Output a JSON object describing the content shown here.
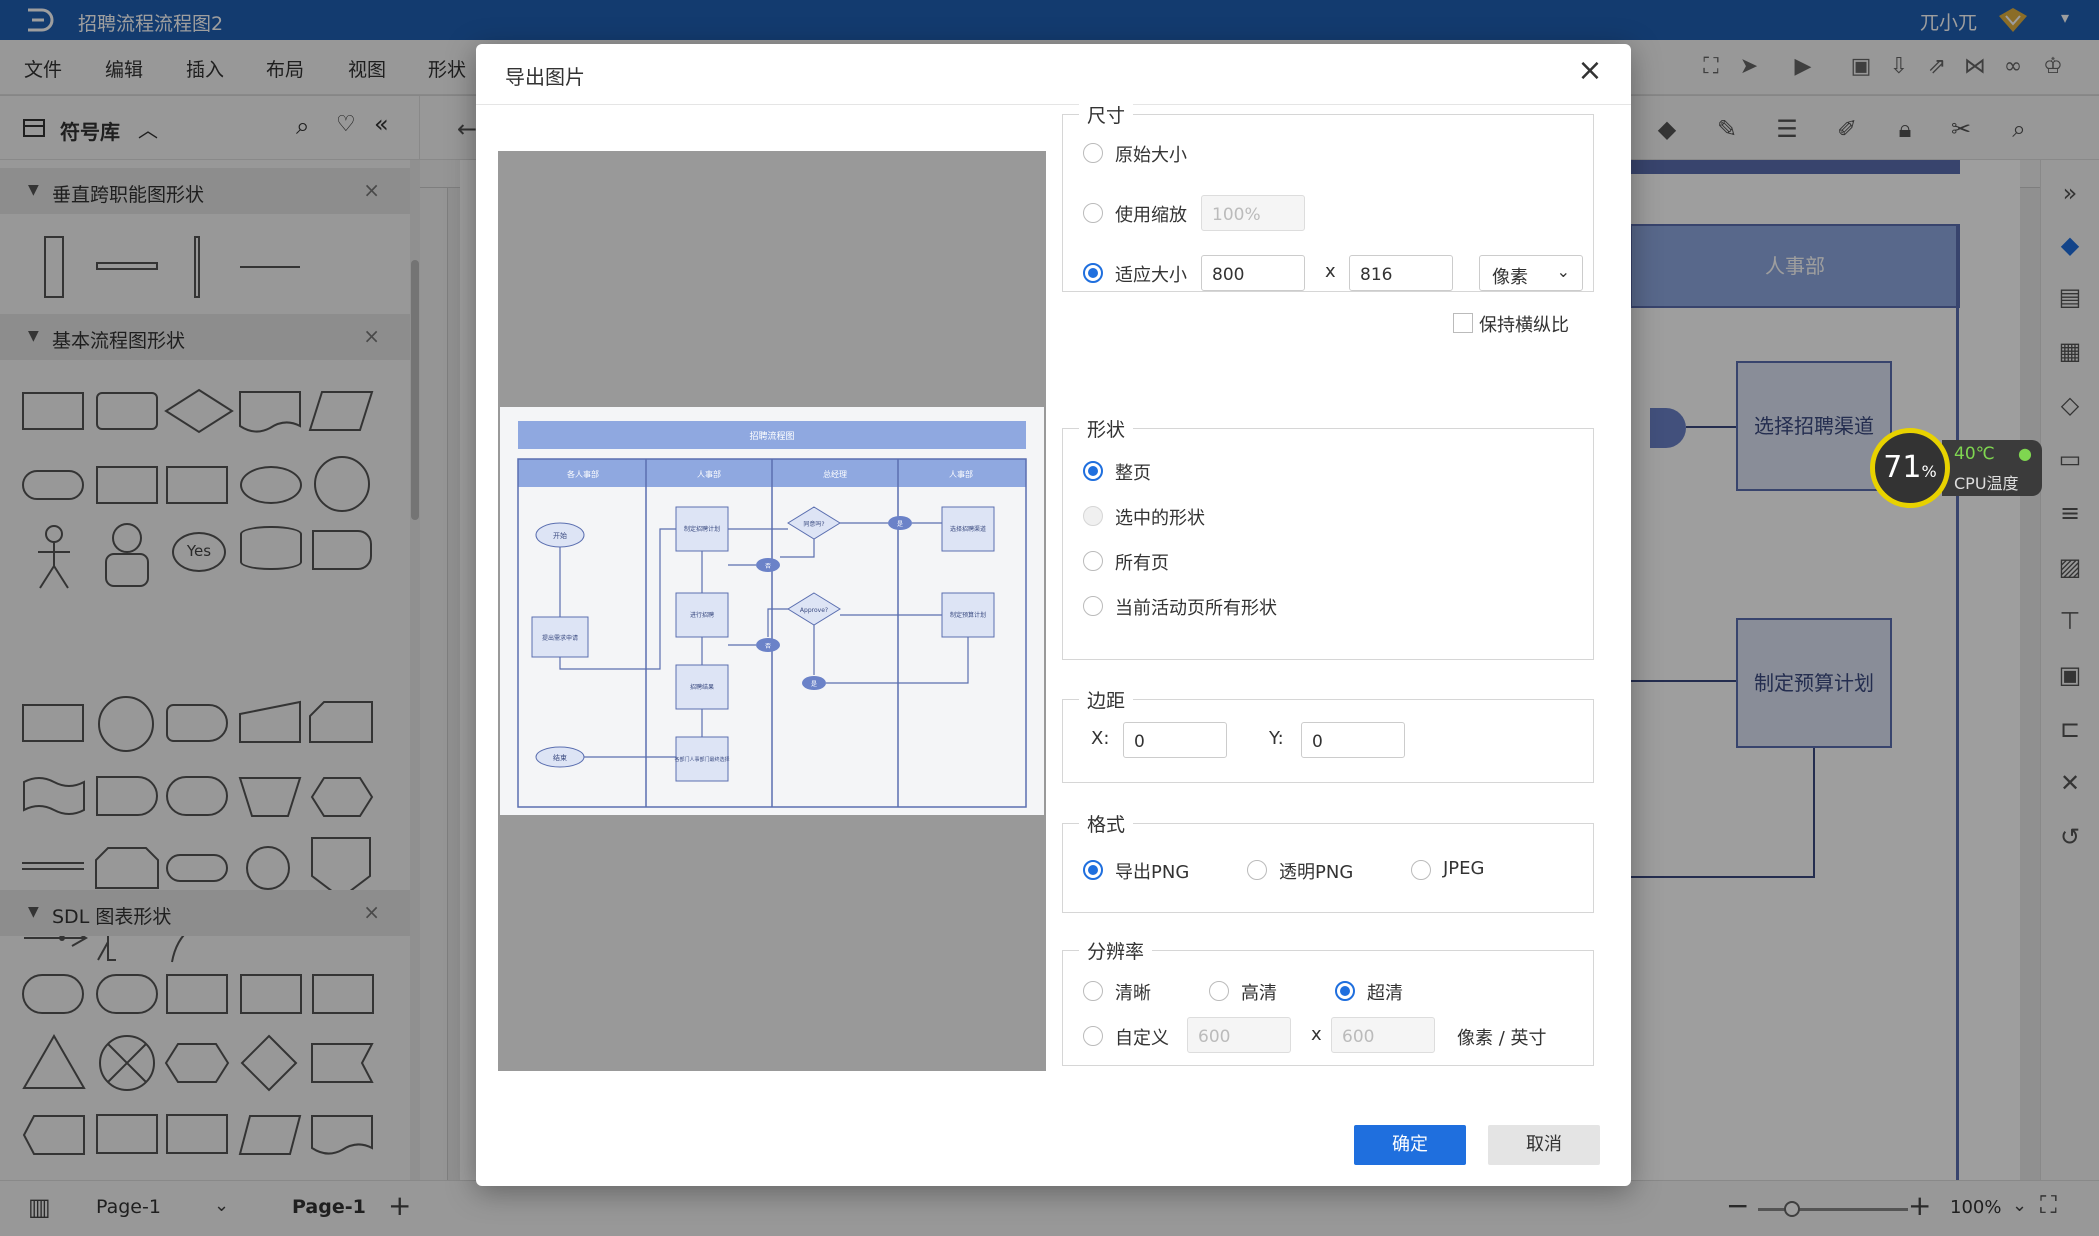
{
  "app": {
    "document_title": "招聘流程流程图2",
    "user_name": "兀小兀"
  },
  "menu": [
    "文件",
    "编辑",
    "插入",
    "布局",
    "视图",
    "形状"
  ],
  "library": {
    "title": "符号库",
    "sections": [
      {
        "title": "垂直跨职能图形状"
      },
      {
        "title": "基本流程图形状",
        "yes_label": "Yes"
      },
      {
        "title": "SDL 图表形状"
      }
    ]
  },
  "canvas": {
    "lane_header": "人事部",
    "box_1": "选择招聘渠道",
    "box_2": "制定预算计划"
  },
  "cpu": {
    "usage": "71",
    "unit": "%",
    "temperature": "40℃",
    "label": "CPU温度"
  },
  "status": {
    "page_selector": "Page-1",
    "active_tab": "Page-1",
    "add": "+",
    "zoom": "100%"
  },
  "dialog": {
    "title": "导出图片",
    "size": {
      "legend": "尺寸",
      "original": "原始大小",
      "scale": "使用缩放",
      "scale_value": "100%",
      "fit": "适应大小",
      "width": "800",
      "height": "816",
      "x": "x",
      "unit": "像素",
      "keep_ratio": "保持横纵比"
    },
    "shape": {
      "legend": "形状",
      "whole_page": "整页",
      "selected": "选中的形状",
      "all_pages": "所有页",
      "current_page_all": "当前活动页所有形状"
    },
    "margin": {
      "legend": "边距",
      "x_label": "X:",
      "x_value": "0",
      "y_label": "Y:",
      "y_value": "0"
    },
    "format": {
      "legend": "格式",
      "png": "导出PNG",
      "transparent_png": "透明PNG",
      "jpeg": "JPEG"
    },
    "resolution": {
      "legend": "分辨率",
      "clear": "清晰",
      "hd": "高清",
      "uhd": "超清",
      "custom": "自定义",
      "w": "600",
      "h": "600",
      "x": "x",
      "unit": "像素 / 英寸"
    },
    "ok": "确定",
    "cancel": "取消"
  },
  "preview": {
    "title_bar": "招聘流程图",
    "lanes": [
      "各人事部",
      "人事部",
      "总经理",
      "人事部"
    ],
    "start": "开始",
    "end": "结束",
    "approve": "Approve?",
    "yes": "是",
    "no": "否",
    "nodes": [
      "提出需求申请",
      "制定招聘计划",
      "选择招聘渠道",
      "进行招聘",
      "制定预算计划",
      "招聘结果",
      "各部门人事部门最终选择"
    ],
    "decision_1": "同意吗?"
  },
  "colors": {
    "accent": "#1f6fde",
    "titlebar": "#1f5fb4",
    "lane": "#8fa8e0"
  }
}
